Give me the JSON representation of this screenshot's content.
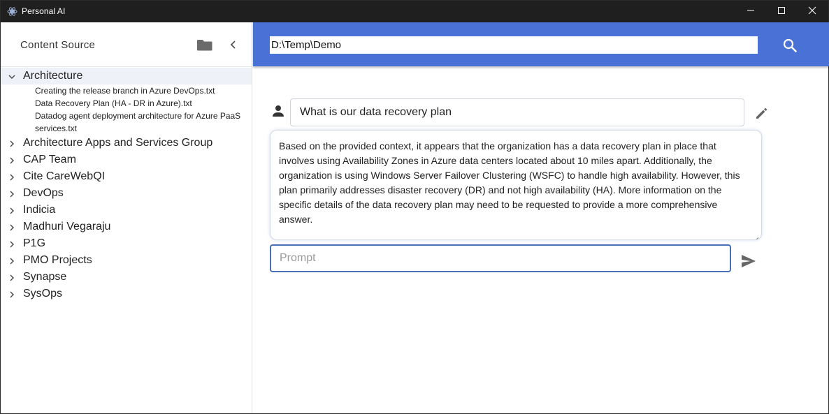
{
  "window": {
    "title": "Personal AI"
  },
  "sidebar": {
    "title": "Content Source",
    "tree": [
      {
        "label": "Architecture",
        "expanded": true,
        "selected": true,
        "children": [
          "Creating the release branch in Azure DevOps.txt",
          "Data Recovery Plan (HA - DR in Azure).txt",
          "Datadog agent deployment architecture for Azure PaaS services.txt"
        ]
      },
      {
        "label": "Architecture Apps and Services Group",
        "expanded": false
      },
      {
        "label": "CAP Team",
        "expanded": false
      },
      {
        "label": "Cite CareWebQI",
        "expanded": false
      },
      {
        "label": "DevOps",
        "expanded": false
      },
      {
        "label": "Indicia",
        "expanded": false
      },
      {
        "label": "Madhuri Vegaraju",
        "expanded": false
      },
      {
        "label": "P1G",
        "expanded": false
      },
      {
        "label": "PMO Projects",
        "expanded": false
      },
      {
        "label": "Synapse",
        "expanded": false
      },
      {
        "label": "SysOps",
        "expanded": false
      }
    ]
  },
  "topbar": {
    "path_value": "D:\\Temp\\Demo",
    "accent_color": "#4a72d6"
  },
  "chat": {
    "question": "What is our data recovery plan",
    "answer": "Based on the provided context, it appears that the organization has a data recovery plan in place that involves using Availability Zones in Azure data centers located about 10 miles apart. Additionally, the organization is using Windows Server Failover Clustering (WSFC) to handle high availability. However, this plan primarily addresses disaster recovery (DR) and not high availability (HA). More information on the specific details of the data recovery plan may need to be requested to provide a more comprehensive answer.",
    "prompt_placeholder": "Prompt",
    "prompt_value": ""
  },
  "icons": {
    "app": "app-logo-icon",
    "minimize": "minimize-icon",
    "maximize": "maximize-icon",
    "close": "close-icon",
    "folder": "folder-icon",
    "collapse": "chevron-left-icon",
    "expand_open": "chevron-down-icon",
    "expand_closed": "chevron-right-icon",
    "search": "search-icon",
    "person": "person-icon",
    "edit": "pencil-icon",
    "send": "send-icon"
  }
}
